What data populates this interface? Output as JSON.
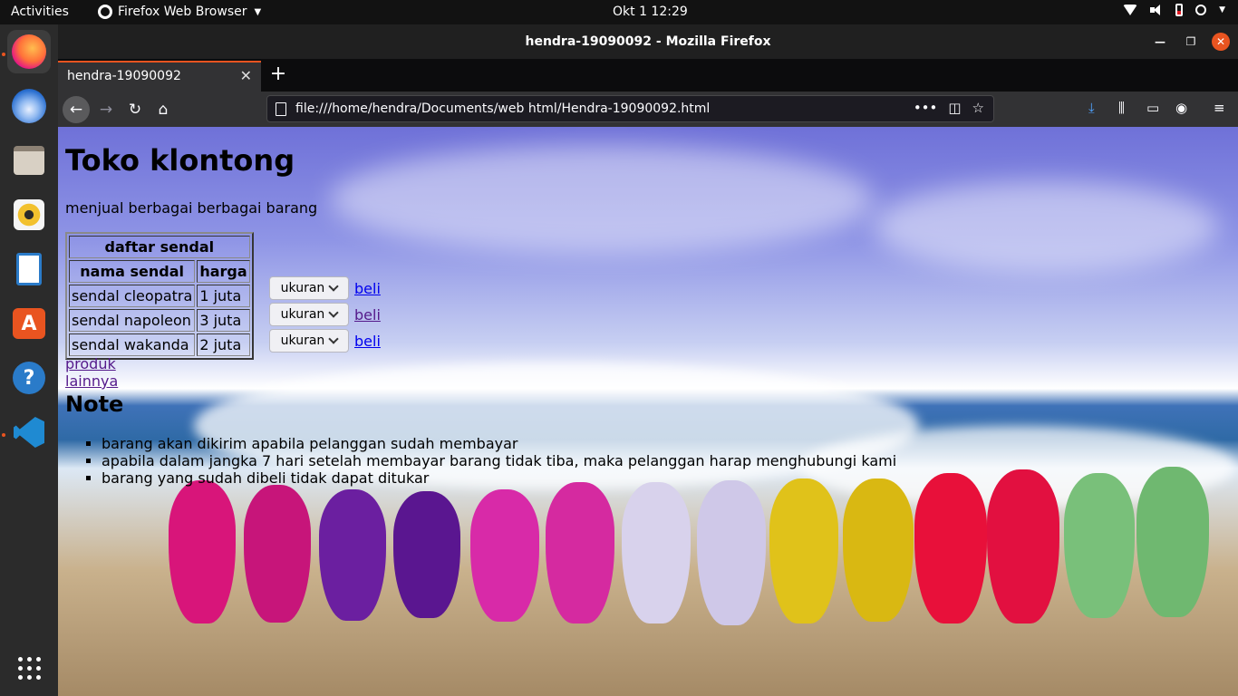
{
  "topbar": {
    "activities": "Activities",
    "app_name": "Firefox Web Browser",
    "clock": "Okt 1  12:29"
  },
  "dock": {
    "apps": [
      "firefox-icon",
      "thunderbird-icon",
      "files-icon",
      "rhythmbox-icon",
      "libreoffice-writer-icon",
      "software-center-icon",
      "help-icon",
      "vscode-icon",
      "show-applications-icon"
    ]
  },
  "window": {
    "title": "hendra-19090092 - Mozilla Firefox"
  },
  "tab": {
    "label": "hendra-19090092"
  },
  "urlbar": {
    "url": "file:///home/hendra/Documents/web html/Hendra-19090092.html"
  },
  "page": {
    "heading": "Toko klontong",
    "description": "menjual berbagai berbagai barang",
    "table": {
      "caption": "daftar sendal",
      "headers": [
        "nama sendal",
        "harga"
      ],
      "rows": [
        {
          "name": "sendal cleopatra",
          "price": "1 juta"
        },
        {
          "name": "sendal napoleon",
          "price": "3 juta"
        },
        {
          "name": "sendal wakanda",
          "price": "2 juta"
        }
      ]
    },
    "select_label": "ukuran",
    "buy_label": "beli",
    "more_link": "produk lainnya",
    "note_heading": "Note",
    "notes": [
      "barang akan dikirim apabila pelanggan sudah membayar",
      "apabila dalam jangka 7 hari setelah membayar barang tidak tiba, maka pelanggan harap menghubungi kami",
      "barang yang sudah dibeli tidak dapat ditukar"
    ]
  },
  "colors": {
    "accent": "#e95420",
    "link": "#0000ee",
    "visited_link": "#551a8b"
  }
}
